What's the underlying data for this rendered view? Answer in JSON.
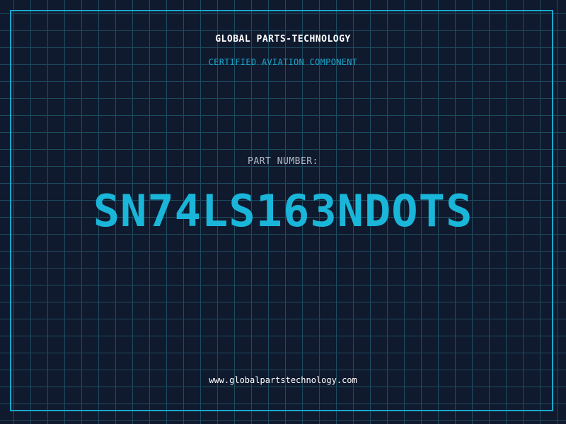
{
  "header": {
    "company": "GLOBAL PARTS-TECHNOLOGY",
    "subtitle": "CERTIFIED AVIATION COMPONENT"
  },
  "part": {
    "label": "PART NUMBER:",
    "number": "SN74LS163NDOTS"
  },
  "footer": {
    "website": "www.globalpartstechnology.com"
  },
  "colors": {
    "background": "#101a2e",
    "grid": "#1e4a5e",
    "accent": "#1ab6d9",
    "label": "#b3bcc8",
    "text": "#ffffff"
  }
}
